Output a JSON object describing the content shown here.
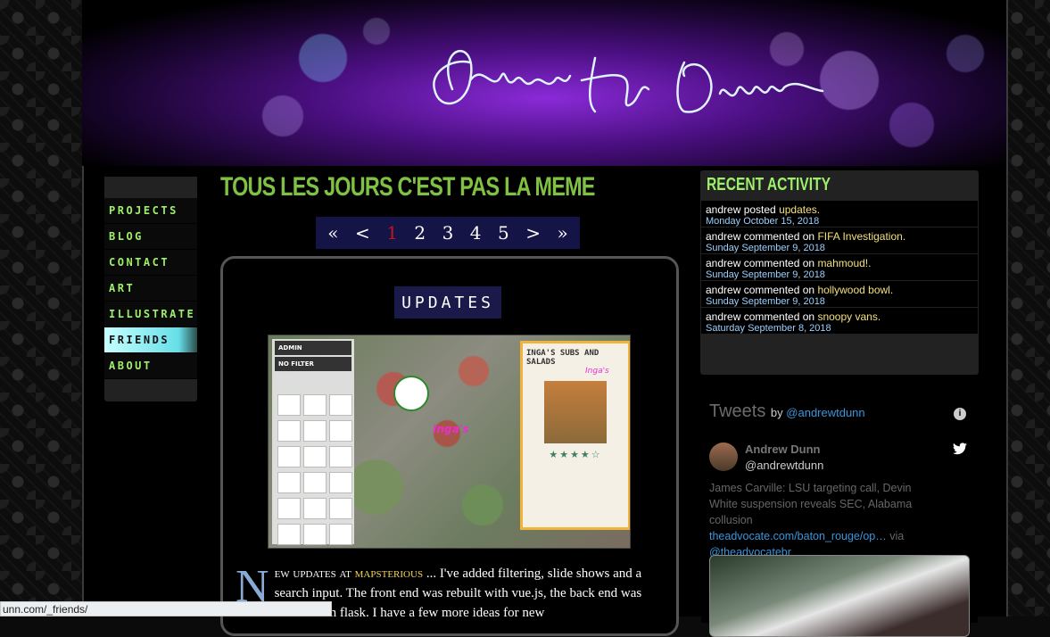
{
  "nav": {
    "items": [
      "PROJECTS",
      "BLOG",
      "CONTACT",
      "ART",
      "ILLUSTRATE",
      "FRIENDS",
      "ABOUT"
    ],
    "active": "FRIENDS"
  },
  "page_title": "TOUS LES JOURS C'EST PAS LA MEME",
  "pager": {
    "first": "«",
    "prev": "<",
    "pages": [
      "1",
      "2",
      "3",
      "4",
      "5"
    ],
    "current": "1",
    "next": ">",
    "last": "»"
  },
  "post": {
    "title": "UPDATES",
    "screenshot": {
      "admin_label": "ADMIN",
      "filter_label": "NO FILTER",
      "card_title": "INGA'S SUBS AND SALADS",
      "card_brand": "Inga's",
      "stars": "★★★★☆",
      "map_label": "Inga's"
    },
    "dropcap": "N",
    "text_start": "ew updates at",
    "link": "mapsterious",
    "text_rest": "... I've added filtering, slide shows and a search input. The front end was rebuilt with vue.js, the back end was rebuilt with flask. I have a few more ideas for new"
  },
  "recent_activity": {
    "title": "RECENT ACTIVITY",
    "items": [
      {
        "actor": "andrew",
        "verb": "posted",
        "target": "updates.",
        "date": "Monday October 15, 2018"
      },
      {
        "actor": "andrew",
        "verb": "commented on",
        "target": "FIFA Investigation.",
        "date": "Sunday September 9, 2018"
      },
      {
        "actor": "andrew",
        "verb": "commented on",
        "target": "mahmoud!.",
        "date": "Sunday September 9, 2018"
      },
      {
        "actor": "andrew",
        "verb": "commented on",
        "target": "hollywood bowl.",
        "date": "Sunday September 9, 2018"
      },
      {
        "actor": "andrew",
        "verb": "commented on",
        "target": "snoopy vans.",
        "date": "Saturday September 8, 2018"
      }
    ]
  },
  "tweets": {
    "title": "Tweets",
    "by": "by",
    "handle_link": "@andrewtdunn",
    "author_name": "Andrew Dunn",
    "author_handle": "@andrewtdunn",
    "text": "James Carville: LSU targeting call, Devin White suspension reveals SEC, Alabama collusion",
    "url": "theadvocate.com/baton_rouge/op…",
    "via": "via",
    "via_handle": "@theadvocatebr"
  },
  "status_url": "unn.com/_friends/"
}
